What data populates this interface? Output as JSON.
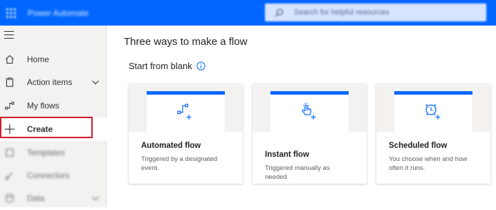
{
  "topbar": {
    "app_title": "Power Automate",
    "search_placeholder": "Search for helpful resources"
  },
  "sidebar": {
    "items": [
      {
        "label": "Home",
        "icon": "home-icon"
      },
      {
        "label": "Action items",
        "icon": "clipboard-icon",
        "has_chevron": true
      },
      {
        "label": "My flows",
        "icon": "flow-icon"
      },
      {
        "label": "Create",
        "icon": "plus-icon",
        "active": true
      },
      {
        "label": "Templates",
        "icon": "templates-icon"
      },
      {
        "label": "Connectors",
        "icon": "connectors-icon"
      },
      {
        "label": "Data",
        "icon": "data-icon",
        "has_chevron": true
      }
    ]
  },
  "main": {
    "page_title": "Three ways to make a flow",
    "section_title": "Start from blank",
    "cards": [
      {
        "title": "Automated flow",
        "description": "Triggered by a designated event.",
        "icon": "automated-flow-icon"
      },
      {
        "title": "Instant flow",
        "description": "Triggered manually as needed.",
        "icon": "instant-flow-icon"
      },
      {
        "title": "Scheduled flow",
        "description": "You choose when and how often it runs.",
        "icon": "scheduled-flow-icon"
      }
    ]
  },
  "colors": {
    "brand": "#0066ff",
    "highlight": "#d11a2a",
    "sidebar_bg": "#f3f2f1"
  }
}
